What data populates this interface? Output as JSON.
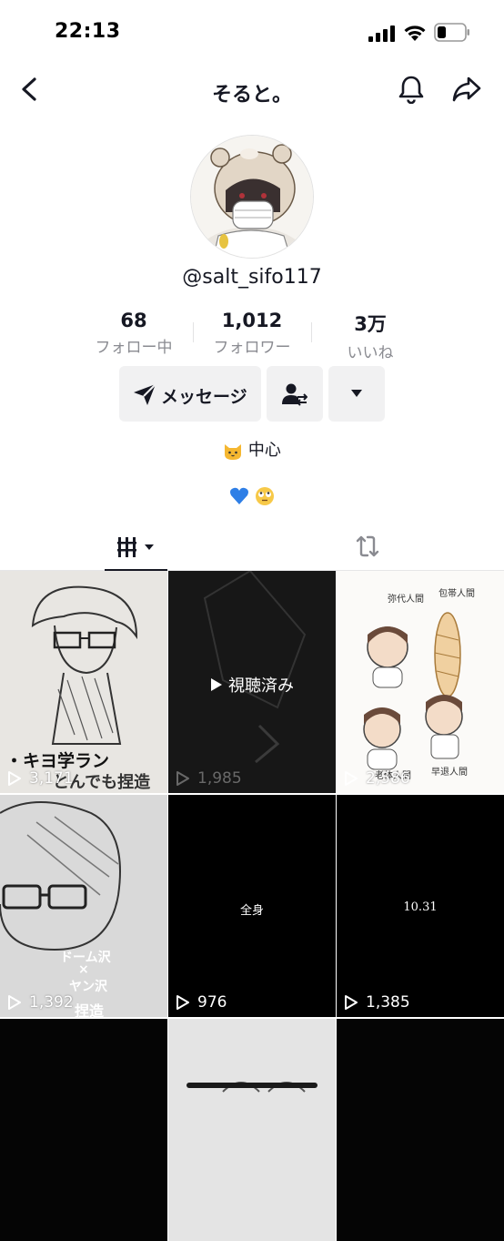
{
  "status_bar": {
    "time": "22:13"
  },
  "nav": {
    "title": "そると。"
  },
  "profile": {
    "username": "@salt_sifo117",
    "stats": [
      {
        "value": "68",
        "label": "フォロー中"
      },
      {
        "value": "1,012",
        "label": "フォロワー"
      },
      {
        "value": "3万",
        "label": "いいね"
      }
    ],
    "message_button": "メッセージ",
    "bio_line1": "中心"
  },
  "videos": [
    {
      "views": "3,171",
      "caption": "・キヨ学ラン",
      "caption2": "とんでも捏造"
    },
    {
      "views": "1,985",
      "watched_label": "視聴済み"
    },
    {
      "views": "2,586",
      "labels": [
        "弥代人間",
        "包帯人間",
        "老体人間",
        "早退人間"
      ]
    },
    {
      "views": "1,392",
      "caption": "ドーム沢",
      "caption_x": "×",
      "caption2": "ヤン沢",
      "caption3": "捏造"
    },
    {
      "views": "976",
      "overlay": "全身"
    },
    {
      "views": "1,385",
      "overlay": "10.31"
    },
    {
      "views": ""
    },
    {
      "views": ""
    },
    {
      "views": ""
    }
  ],
  "colors": {
    "text": "#161823",
    "secondary": "#8a8b91",
    "button_bg": "#f1f1f2",
    "heart": "#2f7fe6"
  }
}
